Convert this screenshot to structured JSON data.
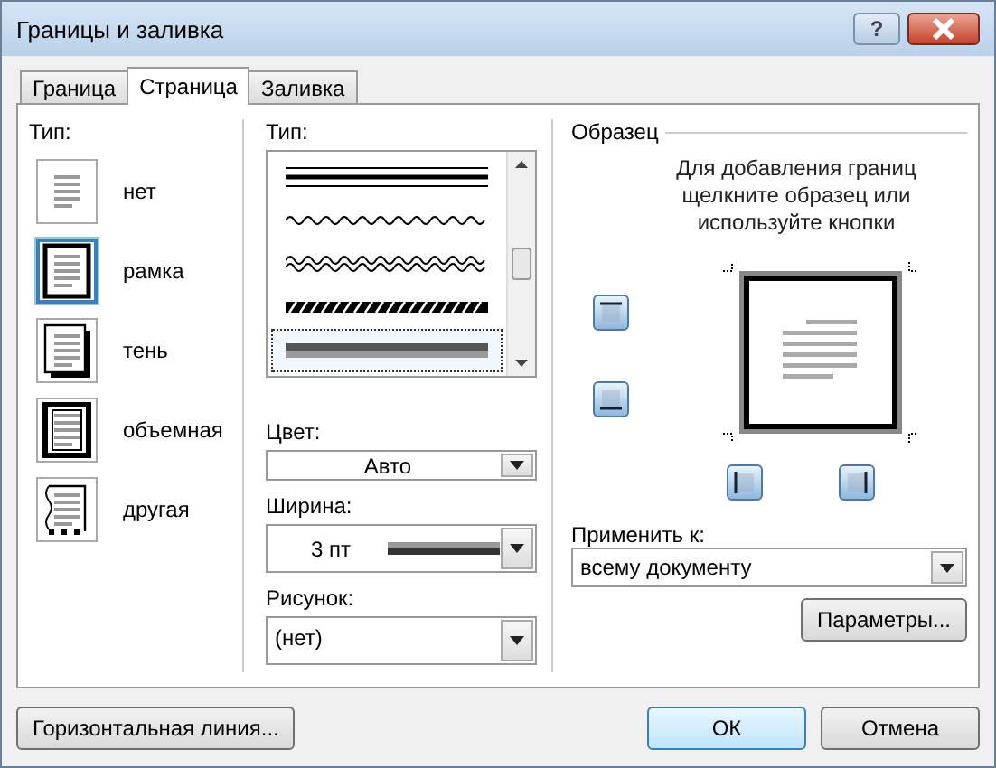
{
  "window": {
    "title": "Границы и заливка",
    "help": "?"
  },
  "tabs": [
    {
      "label": "Граница",
      "selected": false
    },
    {
      "label": "Страница",
      "selected": true
    },
    {
      "label": "Заливка",
      "selected": false
    }
  ],
  "setting": {
    "label": "Тип:",
    "items": [
      {
        "label": "нет",
        "kind": "none",
        "selected": false
      },
      {
        "label": "рамка",
        "kind": "box",
        "selected": true
      },
      {
        "label": "тень",
        "kind": "shadow",
        "selected": false
      },
      {
        "label": "объемная",
        "kind": "raised",
        "selected": false
      },
      {
        "label": "другая",
        "kind": "custom",
        "selected": false
      }
    ]
  },
  "style": {
    "label": "Тип:",
    "lines": [
      {
        "kind": "triple",
        "selected": false
      },
      {
        "kind": "wave",
        "selected": false
      },
      {
        "kind": "double-wave",
        "selected": false
      },
      {
        "kind": "hatched",
        "selected": false
      },
      {
        "kind": "thick-gray",
        "selected": true
      }
    ]
  },
  "color": {
    "label": "Цвет:",
    "value": "Авто"
  },
  "width": {
    "label": "Ширина:",
    "value": "3 пт"
  },
  "art": {
    "label": "Рисунок:",
    "value": "(нет)"
  },
  "preview": {
    "title": "Образец",
    "hint": "Для добавления границ щелкните образец или используйте кнопки",
    "border_buttons": [
      {
        "kind": "top"
      },
      {
        "kind": "bottom"
      },
      {
        "kind": "left"
      },
      {
        "kind": "right"
      }
    ]
  },
  "apply": {
    "label": "Применить к:",
    "value": "всему документу"
  },
  "options_button": "Параметры...",
  "horizontal_line_button": "Горизонтальная линия...",
  "ok_button": "ОК",
  "cancel_button": "Отмена"
}
